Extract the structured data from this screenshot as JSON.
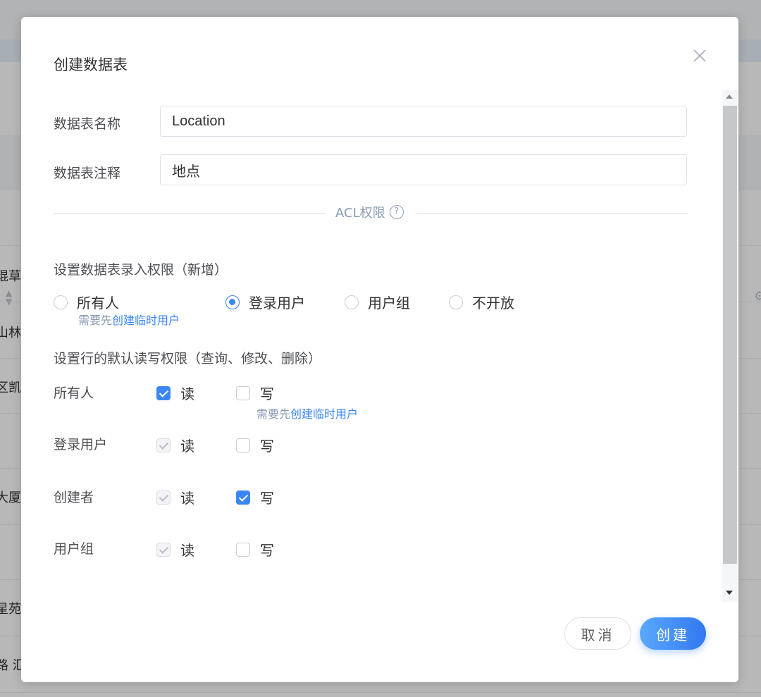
{
  "background": {
    "row_fragments": [
      "琨草",
      "山林",
      "区凯",
      "大厦",
      "星苑",
      "路 汇"
    ]
  },
  "dialog": {
    "title": "创建数据表",
    "fields": {
      "name_label": "数据表名称",
      "name_value": "Location",
      "comment_label": "数据表注释",
      "comment_value": "地点"
    },
    "divider_label": "ACL权限",
    "help_icon_glyph": "?",
    "create_permission": {
      "title": "设置数据表录入权限（新增）",
      "options": [
        {
          "label": "所有人",
          "checked": false
        },
        {
          "label": "登录用户",
          "checked": true
        },
        {
          "label": "用户组",
          "checked": false
        },
        {
          "label": "不开放",
          "checked": false
        }
      ],
      "hint_prefix": "需要先",
      "hint_link": "创建临时用户"
    },
    "row_permission": {
      "title": "设置行的默认读写权限（查询、修改、删除）",
      "read_label": "读",
      "write_label": "写",
      "rows": [
        {
          "label": "所有人",
          "read": "checked",
          "write": "unchecked"
        },
        {
          "label": "登录用户",
          "read": "disabled-checked",
          "write": "unchecked"
        },
        {
          "label": "创建者",
          "read": "disabled-checked",
          "write": "checked"
        },
        {
          "label": "用户组",
          "read": "disabled-checked",
          "write": "unchecked"
        }
      ],
      "hint_prefix": "需要先",
      "hint_link": "创建临时用户"
    },
    "buttons": {
      "cancel": "取消",
      "create": "创建"
    }
  },
  "colors": {
    "accent": "#3a86f7",
    "hint": "#8a9bb5",
    "label": "#4d4f53"
  },
  "icons": [
    "close-icon",
    "help-icon",
    "sort-icon",
    "gear-icon",
    "scroll-up-icon",
    "scroll-down-icon"
  ]
}
